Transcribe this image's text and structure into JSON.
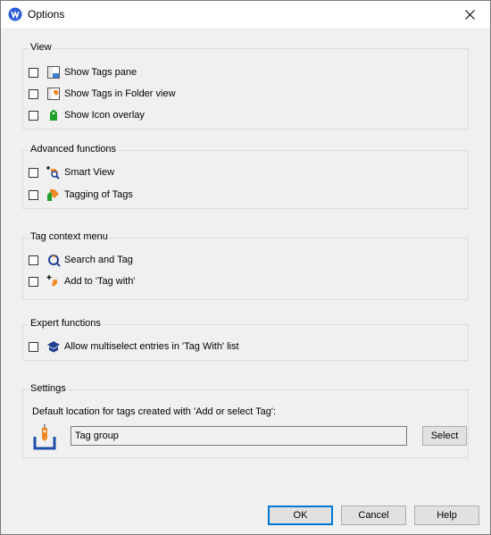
{
  "window": {
    "title": "Options"
  },
  "groups": {
    "view": {
      "title": "View",
      "items": [
        {
          "label": "Show Tags pane",
          "checked": false,
          "icon": "tags-pane-icon"
        },
        {
          "label": "Show Tags in Folder view",
          "checked": false,
          "icon": "folder-tags-icon"
        },
        {
          "label": "Show Icon overlay",
          "checked": false,
          "icon": "icon-overlay-icon"
        }
      ]
    },
    "advanced": {
      "title": "Advanced functions",
      "items": [
        {
          "label": "Smart View",
          "checked": false,
          "icon": "smart-view-icon"
        },
        {
          "label": "Tagging of Tags",
          "checked": false,
          "icon": "tagging-of-tags-icon"
        }
      ]
    },
    "context": {
      "title": "Tag context menu",
      "items": [
        {
          "label": "Search and Tag",
          "checked": false,
          "icon": "search-and-tag-icon"
        },
        {
          "label": "Add to 'Tag with'",
          "checked": false,
          "icon": "add-to-tag-with-icon"
        }
      ]
    },
    "expert": {
      "title": "Expert functions",
      "items": [
        {
          "label": "Allow multiselect entries in 'Tag With' list",
          "checked": false,
          "icon": "multiselect-icon"
        }
      ]
    },
    "settings": {
      "title": "Settings",
      "description": "Default location for tags created with 'Add or select Tag':",
      "location_value": "Tag group",
      "select_label": "Select"
    }
  },
  "buttons": {
    "ok": "OK",
    "cancel": "Cancel",
    "help": "Help"
  },
  "colors": {
    "accent": "#0078d7",
    "tag_orange": "#f08a24",
    "navy": "#1f3f8f",
    "green": "#1fa12a"
  }
}
